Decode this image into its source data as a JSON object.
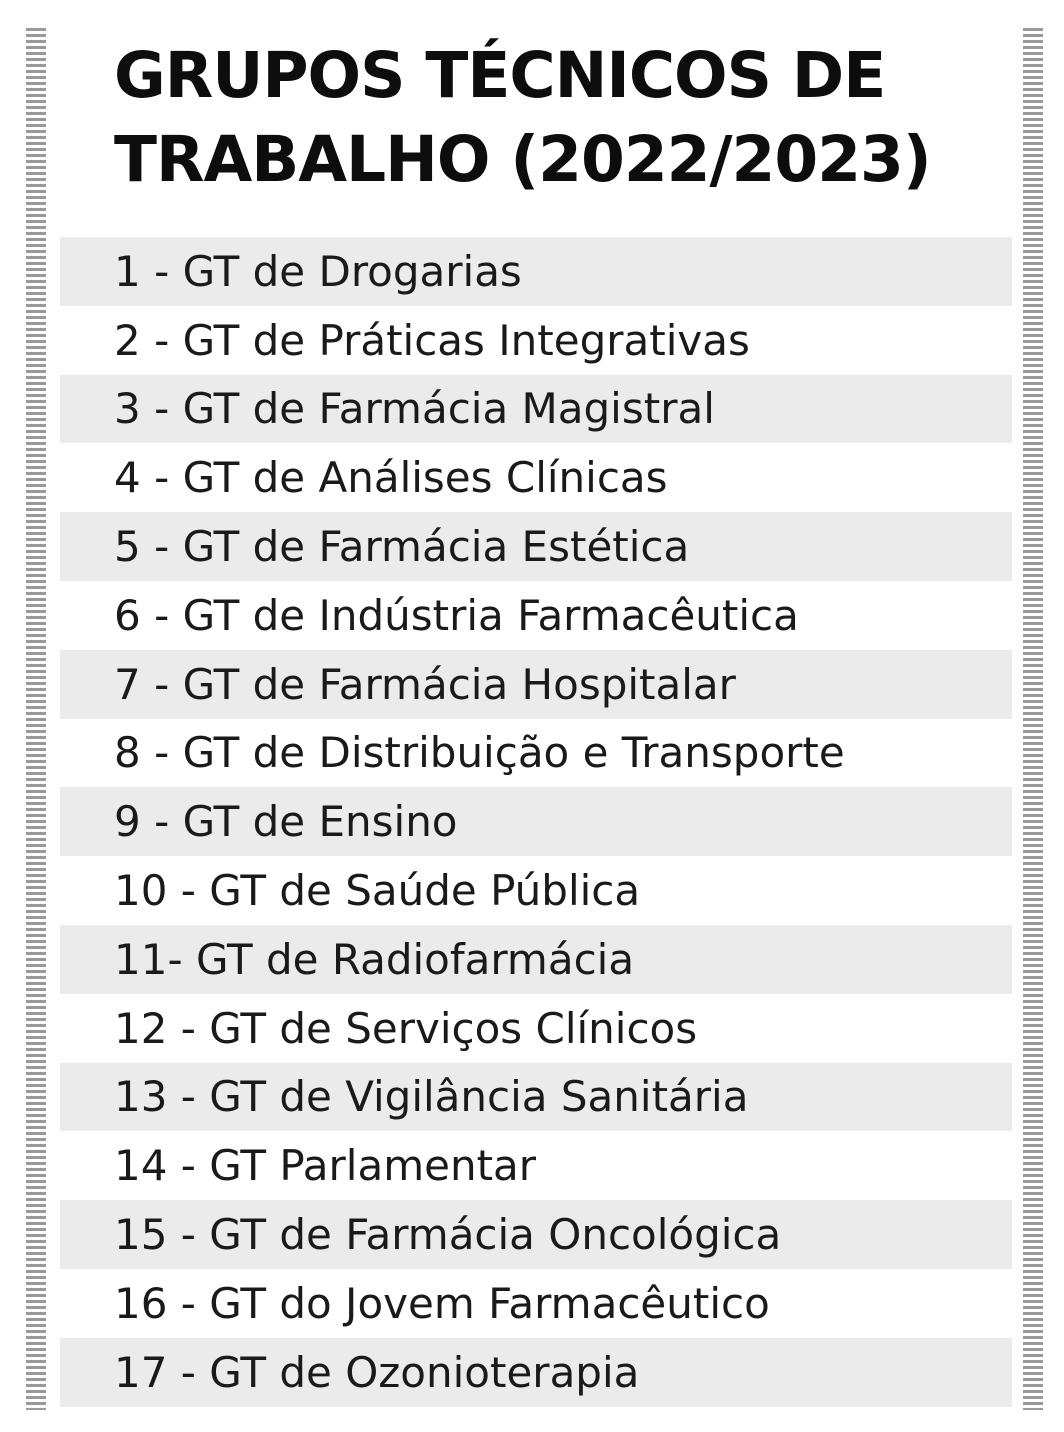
{
  "title": {
    "line1": "GRUPOS TÉCNICOS DE",
    "line2": "TRABALHO (2022/2023)"
  },
  "items": [
    "1 - GT de Drogarias",
    "2 - GT de Práticas Integrativas",
    "3 - GT de Farmácia Magistral",
    "4 - GT de Análises Clínicas",
    "5 - GT de Farmácia Estética",
    "6 - GT de Indústria Farmacêutica",
    "7 - GT de Farmácia Hospitalar",
    "8 - GT de Distribuição e Transporte",
    "9 - GT de Ensino",
    "10 - GT de Saúde Pública",
    "11- GT de Radiofarmácia",
    "12 - GT de Serviços Clínicos",
    "13 - GT de Vigilância Sanitária",
    "14 - GT Parlamentar",
    "15 - GT de Farmácia Oncológica",
    "16 - GT do Jovem Farmacêutico",
    "17 - GT de Ozonioterapia"
  ],
  "colors": {
    "row_shade": "#ebebeb",
    "stripe": "#9a9a9a",
    "text": "#1a1a1a"
  }
}
